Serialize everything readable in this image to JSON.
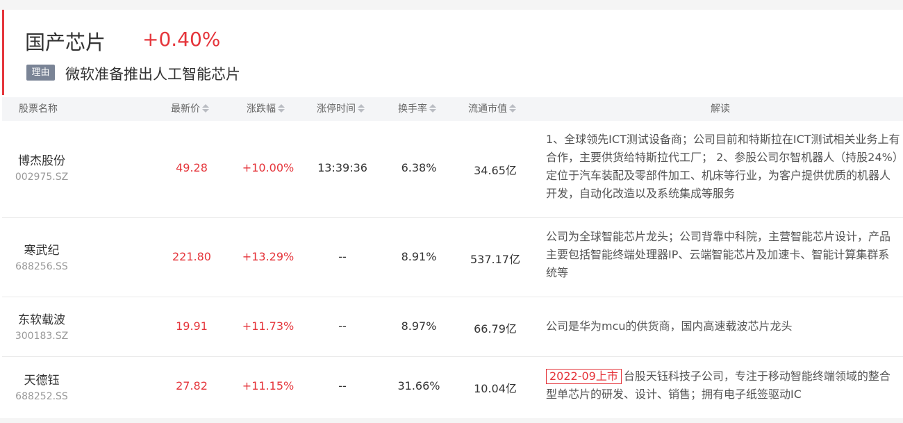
{
  "sector": {
    "title": "国产芯片",
    "change": "+0.40%",
    "reason_tag": "理由",
    "reason": "微软准备推出人工智能芯片"
  },
  "table": {
    "headers": {
      "name": "股票名称",
      "price": "最新价",
      "change": "涨跌幅",
      "limit_time": "涨停时间",
      "turnover": "换手率",
      "market_cap": "流通市值",
      "interpretation": "解读"
    },
    "rows": [
      {
        "name": "博杰股份",
        "code": "002975.SZ",
        "price": "49.28",
        "change": "+10.00%",
        "limit_time": "13:39:36",
        "turnover": "6.38%",
        "market_cap": "34.65亿",
        "ipo_tag": "",
        "interpretation": "1、全球领先ICT测试设备商；公司目前和特斯拉在ICT测试相关业务上有合作，主要供货给特斯拉代工厂； 2、参股公司尔智机器人（持股24%）定位于汽车装配及零部件加工、机床等行业，为客户提供优质的机器人开发，自动化改造以及系统集成等服务"
      },
      {
        "name": "寒武纪",
        "code": "688256.SS",
        "price": "221.80",
        "change": "+13.29%",
        "limit_time": "--",
        "turnover": "8.91%",
        "market_cap": "537.17亿",
        "ipo_tag": "",
        "interpretation": "公司为全球智能芯片龙头；公司背靠中科院，主营智能芯片设计，产品主要包括智能终端处理器IP、云端智能芯片及加速卡、智能计算集群系统等"
      },
      {
        "name": "东软载波",
        "code": "300183.SZ",
        "price": "19.91",
        "change": "+11.73%",
        "limit_time": "--",
        "turnover": "8.97%",
        "market_cap": "66.79亿",
        "ipo_tag": "",
        "interpretation": "公司是华为mcu的供货商，国内高速载波芯片龙头"
      },
      {
        "name": "天德钰",
        "code": "688252.SS",
        "price": "27.82",
        "change": "+11.15%",
        "limit_time": "--",
        "turnover": "31.66%",
        "market_cap": "10.04亿",
        "ipo_tag": "2022-09上市",
        "interpretation": "台股天钰科技子公司，专注于移动智能终端领域的整合型单芯片的研发、设计、销售；拥有电子纸签驱动IC"
      }
    ]
  },
  "colors": {
    "up": "#e5353b",
    "tag_bg": "#7a8496"
  }
}
